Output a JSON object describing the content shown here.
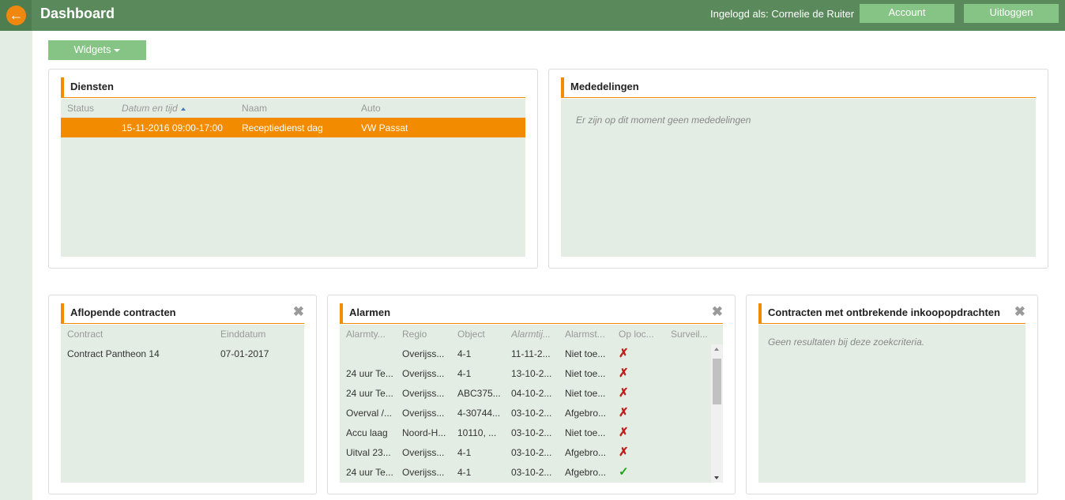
{
  "header": {
    "back_icon": "arrow-left-icon",
    "title": "Dashboard",
    "logged_in": "Ingelogd als: Cornelie de Ruiter",
    "account_label": "Account",
    "logout_label": "Uitloggen",
    "bar_color": "#5a8a5c",
    "button_color": "#86c486",
    "accent_color": "#f28b00"
  },
  "toolbar": {
    "widgets_label": "Widgets"
  },
  "diensten": {
    "title": "Diensten",
    "columns": [
      "Status",
      "Datum en tijd",
      "Naam",
      "Auto"
    ],
    "rows": [
      {
        "status": "",
        "datum": "15-11-2016 09:00-17:00",
        "naam": "Receptiedienst dag",
        "auto": "VW Passat"
      }
    ]
  },
  "mededelingen": {
    "title": "Mededelingen",
    "empty": "Er zijn op dit moment geen mededelingen"
  },
  "aflopende": {
    "title": "Aflopende contracten",
    "columns": [
      "Contract",
      "Einddatum"
    ],
    "rows": [
      {
        "contract": "Contract Pantheon 14",
        "einddatum": "07-01-2017"
      }
    ]
  },
  "alarmen": {
    "title": "Alarmen",
    "columns": [
      "Alarmty...",
      "Regio",
      "Object",
      "Alarmtij...",
      "Alarmst...",
      "Op loc...",
      "Surveil..."
    ],
    "rows": [
      {
        "type": "",
        "regio": "Overijss...",
        "object": "4-1",
        "tijd": "11-11-2...",
        "status": "Niet toe...",
        "oploc": "✗"
      },
      {
        "type": "24 uur Te...",
        "regio": "Overijss...",
        "object": "4-1",
        "tijd": "13-10-2...",
        "status": "Niet toe...",
        "oploc": "✗"
      },
      {
        "type": "24 uur Te...",
        "regio": "Overijss...",
        "object": "ABC375...",
        "tijd": "04-10-2...",
        "status": "Niet toe...",
        "oploc": "✗"
      },
      {
        "type": "Overval /...",
        "regio": "Overijss...",
        "object": "4-30744...",
        "tijd": "03-10-2...",
        "status": "Afgebro...",
        "oploc": "✗"
      },
      {
        "type": "Accu laag",
        "regio": "Noord-H...",
        "object": "10110, ...",
        "tijd": "03-10-2...",
        "status": "Niet toe...",
        "oploc": "✗"
      },
      {
        "type": "Uitval 23...",
        "regio": "Overijss...",
        "object": "4-1",
        "tijd": "03-10-2...",
        "status": "Afgebro...",
        "oploc": "✗"
      },
      {
        "type": "24 uur Te...",
        "regio": "Overijss...",
        "object": "4-1",
        "tijd": "03-10-2...",
        "status": "Afgebro...",
        "oploc": "✓"
      }
    ]
  },
  "inkoop": {
    "title": "Contracten met ontbrekende inkoopopdrachten",
    "empty": "Geen resultaten bij deze zoekcriteria."
  }
}
